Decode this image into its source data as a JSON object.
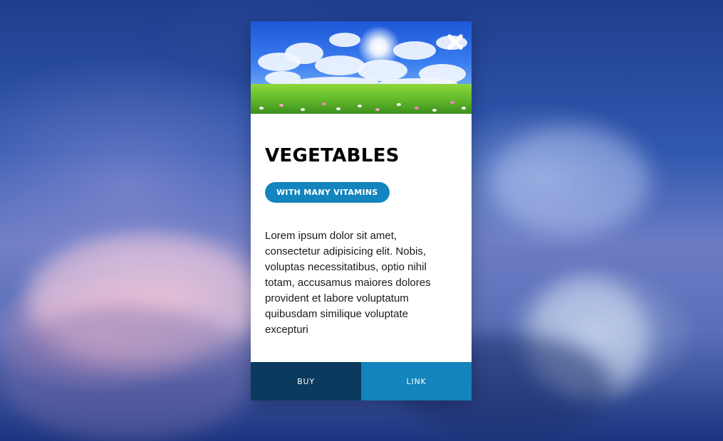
{
  "modal": {
    "title": "VEGETABLES",
    "badge": "WITH MANY VITAMINS",
    "description": "Lorem ipsum dolor sit amet, consectetur adipisicing elit. Nobis, voluptas necessitatibus, optio nihil totam, accusamus maiores dolores provident et labore voluptatum quibusdam similique voluptate excepturi",
    "close_icon": "close-icon",
    "hero_image": "meadow-sky-image",
    "buttons": {
      "buy_label": "BUY",
      "link_label": "LINK"
    }
  },
  "colors": {
    "accent": "#1384bd",
    "buy_bg": "#0b3a5e",
    "title": "#000000"
  }
}
